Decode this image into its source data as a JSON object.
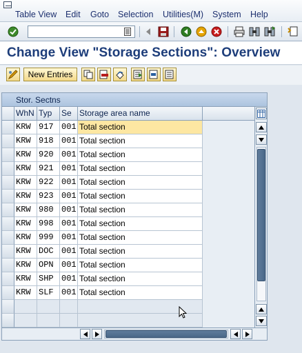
{
  "menu": {
    "items": [
      "Table View",
      "Edit",
      "Goto",
      "Selection",
      "Utilities(M)",
      "System",
      "Help"
    ]
  },
  "toolbar": {
    "command_field_value": "",
    "icons": [
      "enter-icon",
      "back-icon",
      "save-icon",
      "back-nav-icon",
      "exit-icon",
      "cancel-icon",
      "print-icon",
      "find-icon",
      "find-next-icon",
      "first-page-icon"
    ]
  },
  "page": {
    "title": "Change View \"Storage Sections\": Overview"
  },
  "app_toolbar": {
    "new_entries_label": "New Entries",
    "icons": [
      "change-display-icon",
      "copy-as-icon",
      "delete-icon",
      "undo-change-icon",
      "select-all-icon",
      "select-block-icon",
      "deselect-all-icon"
    ]
  },
  "table": {
    "caption": "Stor. Sectns",
    "columns": [
      "WhN",
      "Typ",
      "Se",
      "Storage area name"
    ],
    "rows": [
      [
        "KRW",
        "917",
        "001",
        "Total section"
      ],
      [
        "KRW",
        "918",
        "001",
        "Total section"
      ],
      [
        "KRW",
        "920",
        "001",
        "Total section"
      ],
      [
        "KRW",
        "921",
        "001",
        "Total section"
      ],
      [
        "KRW",
        "922",
        "001",
        "Total section"
      ],
      [
        "KRW",
        "923",
        "001",
        "Total section"
      ],
      [
        "KRW",
        "980",
        "001",
        "Total section"
      ],
      [
        "KRW",
        "998",
        "001",
        "Total section"
      ],
      [
        "KRW",
        "999",
        "001",
        "Total section"
      ],
      [
        "KRW",
        "DOC",
        "001",
        "Total section"
      ],
      [
        "KRW",
        "OPN",
        "001",
        "Total section"
      ],
      [
        "KRW",
        "SHP",
        "001",
        "Total section"
      ],
      [
        "KRW",
        "SLF",
        "001",
        "Total section"
      ]
    ],
    "empty_rows": 2
  },
  "colors": {
    "title": "#1d3d7a",
    "highlight_row": "#fde7a2",
    "button_face": "#f3d98a"
  }
}
